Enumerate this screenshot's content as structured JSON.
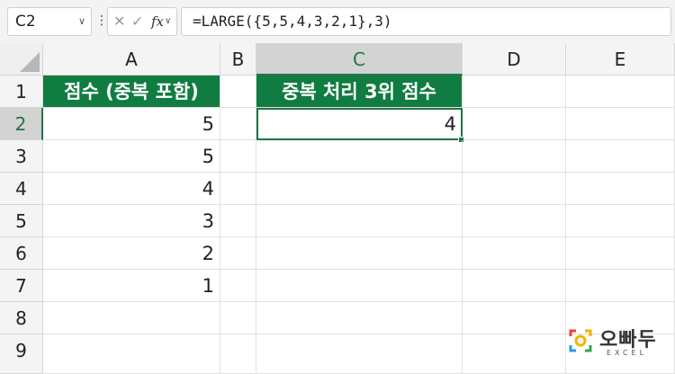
{
  "name_box": {
    "value": "C2"
  },
  "formula_bar": {
    "fx_label": "fx",
    "formula": "=LARGE({5,5,4,3,2,1},3)"
  },
  "columns": [
    "A",
    "B",
    "C",
    "D",
    "E"
  ],
  "selected_column": "C",
  "rows": [
    "1",
    "2",
    "3",
    "4",
    "5",
    "6",
    "7",
    "8",
    "9"
  ],
  "selected_row": "2",
  "cells": {
    "A1": "점수 (중복 포함)",
    "A2": "5",
    "A3": "5",
    "A4": "4",
    "A5": "3",
    "A6": "2",
    "A7": "1",
    "C1": "중복 처리 3위 점수",
    "C2": "4"
  },
  "colors": {
    "header_fill": "#107c41",
    "selection": "#217346"
  },
  "logo": {
    "text": "오빠두",
    "sub": "EXCEL"
  }
}
